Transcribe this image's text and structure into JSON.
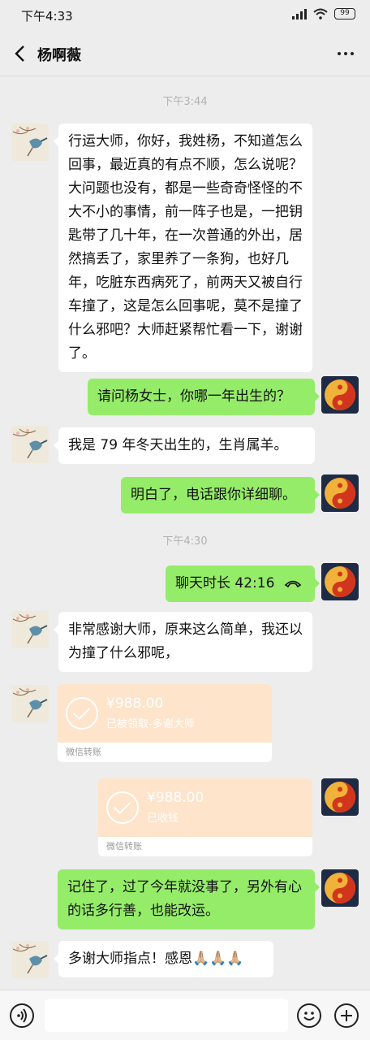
{
  "status_bar": {
    "time": "下午4:33",
    "battery": "99"
  },
  "header": {
    "title": "杨啊薇"
  },
  "time_labels": [
    "下午3:44",
    "下午4:30"
  ],
  "messages": [
    {
      "side": "left",
      "text": "行运大师，你好，我姓杨，不知道怎么回事，最近真的有点不顺，怎么说呢？大问题也没有，都是一些奇奇怪怪的不大不小的事情，前一阵子也是，一把钥匙带了几十年，在一次普通的外出，居然搞丢了，家里养了一条狗，也好几年，吃脏东西病死了，前两天又被自行车撞了，这是怎么回事呢，莫不是撞了什么邪吧？大师赶紧帮忙看一下，谢谢了。"
    },
    {
      "side": "right",
      "text": "请问杨女士，你哪一年出生的？"
    },
    {
      "side": "left",
      "text": "我是 79 年冬天出生的，生肖属羊。"
    },
    {
      "side": "right",
      "text": "明白了，电话跟你详细聊。"
    },
    {
      "side": "right",
      "text": "聊天时长 42:16"
    },
    {
      "side": "left",
      "text": "非常感谢大师，原来这么简单，我还以为撞了什么邪呢，"
    },
    {
      "side": "right",
      "text": "记住了，过了今年就没事了，另外有心的话多行善，也能改运。"
    },
    {
      "side": "left",
      "text": "多谢大师指点！感恩🙏🏼🙏🏼🙏🏼"
    }
  ],
  "transfers": [
    {
      "side": "left",
      "amount": "¥988.00",
      "status": "已被领取-多谢大师",
      "footer": "微信转账"
    },
    {
      "side": "right",
      "amount": "¥988.00",
      "status": "已收钱",
      "footer": "微信转账"
    }
  ],
  "colors": {
    "green_bubble": "#95ec69",
    "transfer_bg": "#fde4cb",
    "background": "#ededed"
  },
  "icons": {
    "back": "chevron-left-icon",
    "more": "more-dots-icon",
    "voice": "voice-icon",
    "emoji": "emoji-icon",
    "plus": "plus-icon",
    "call": "phone-hangup-icon"
  }
}
